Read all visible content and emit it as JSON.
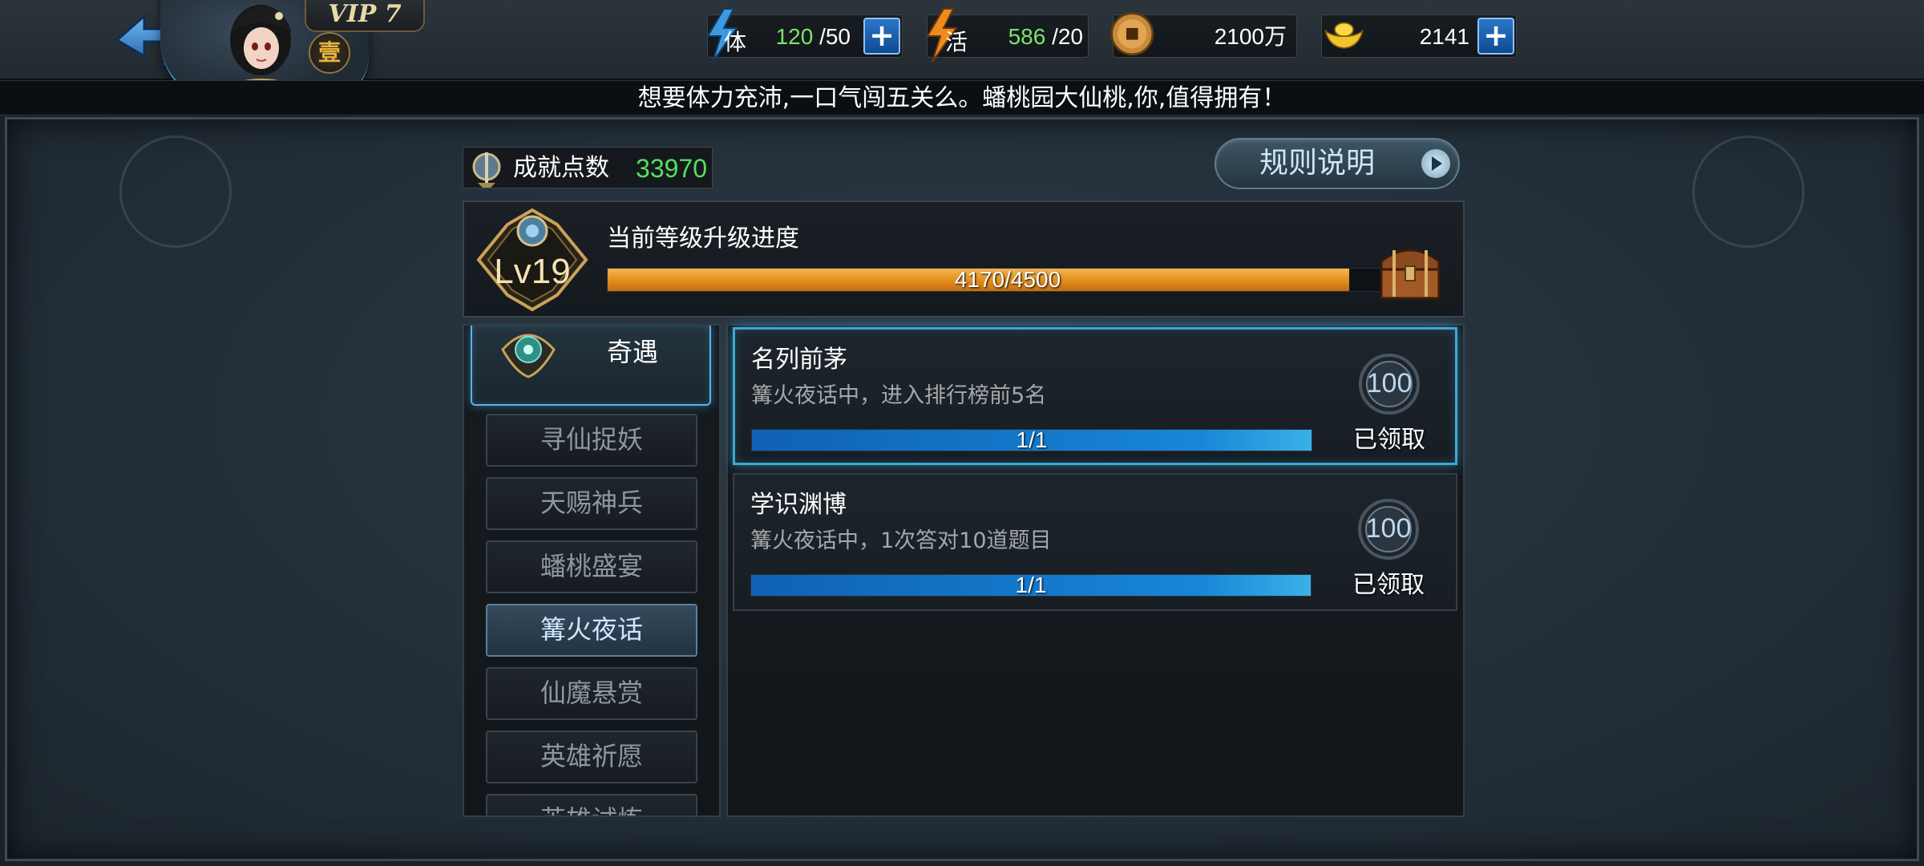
{
  "hud": {
    "vip_label": "VIP 7",
    "rank_label": "壹",
    "stamina": {
      "icon": "lightning-icon",
      "icon_char": "体",
      "current": "120",
      "max": "/50"
    },
    "vitality": {
      "icon": "lightning-icon",
      "icon_char": "活",
      "current": "586",
      "max": "/20"
    },
    "coins": {
      "icon": "copper-coin-icon",
      "value": "2100万"
    },
    "gold": {
      "icon": "gold-ingot-icon",
      "value": "2141"
    },
    "plus_glyph": "+"
  },
  "marquee": {
    "text": "想要体力充沛,一口气闯五关么。蟠桃园大仙桃,你,值得拥有！"
  },
  "achievement": {
    "label": "成就点数",
    "value": "33970",
    "rules_button": "规则说明"
  },
  "level": {
    "badge": "Lv19",
    "title": "当前等级升级进度",
    "progress_text": "4170/4500",
    "progress": {
      "current": 4170,
      "max": 4500
    }
  },
  "sidebar": {
    "header": "奇遇",
    "items": [
      {
        "label": "寻仙捉妖",
        "active": false
      },
      {
        "label": "天赐神兵",
        "active": false
      },
      {
        "label": "蟠桃盛宴",
        "active": false
      },
      {
        "label": "篝火夜话",
        "active": true
      },
      {
        "label": "仙魔悬赏",
        "active": false
      },
      {
        "label": "英雄祈愿",
        "active": false
      },
      {
        "label": "英雄试炼",
        "active": false
      }
    ]
  },
  "tasks": [
    {
      "name": "名列前茅",
      "desc": "篝火夜话中，进入排行榜前5名",
      "progress_text": "1/1",
      "progress": 1.0,
      "reward": "100",
      "status": "已领取"
    },
    {
      "name": "学识渊博",
      "desc": "篝火夜话中，1次答对10道题目",
      "progress_text": "1/1",
      "progress": 1.0,
      "reward": "100",
      "status": "已领取"
    }
  ],
  "colors": {
    "green_value": "#54e05a",
    "stamina_green": "#7be36b",
    "orange_bar": "#e59121",
    "blue_bar": "#1886d6",
    "highlight_border": "#3fa6d8"
  }
}
